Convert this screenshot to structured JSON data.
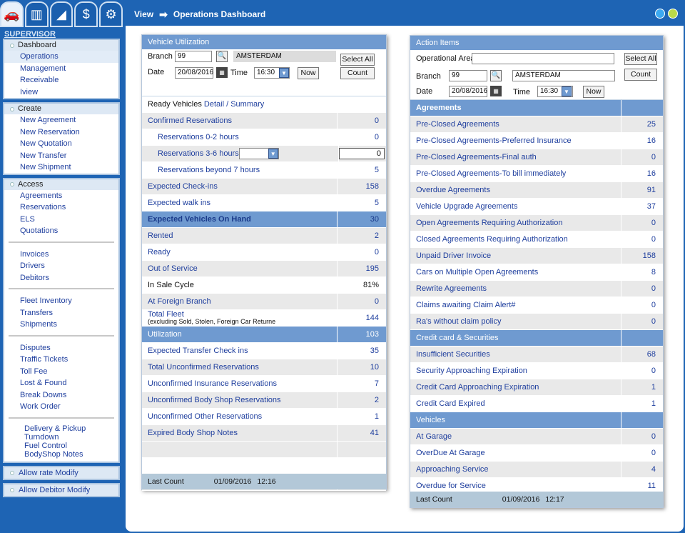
{
  "tabs": [
    {
      "icon": "car-icon"
    },
    {
      "icon": "chart-icon"
    },
    {
      "icon": "steps-icon"
    },
    {
      "icon": "dollar-icon"
    },
    {
      "icon": "gears-icon"
    }
  ],
  "sidebar": {
    "role": "SUPERVISOR",
    "dashboard": {
      "items": [
        "Dashboard",
        "Operations",
        "Management",
        "Receivable",
        "Iview"
      ]
    },
    "create": {
      "title": "Create",
      "items": [
        "New Agreement",
        "New Reservation",
        "New Quotation",
        "New Transfer",
        "New Shipment"
      ]
    },
    "access": {
      "title": "Access",
      "group1": [
        "Agreements",
        "Reservations",
        "ELS",
        "Quotations"
      ],
      "group2": [
        "Invoices",
        "Drivers",
        "Debitors"
      ],
      "group3": [
        "Fleet Inventory",
        "Transfers",
        "Shipments"
      ],
      "group4": [
        "Disputes",
        "Traffic Tickets",
        "Toll Fee",
        "Lost & Found",
        "Break Downs",
        "Work Order"
      ],
      "group5": [
        "Delivery & Pickup",
        "Turndown",
        "Fuel Control",
        "BodyShop Notes"
      ]
    },
    "allow_rate": "Allow rate Modify",
    "allow_debitor": "Allow Debitor Modify"
  },
  "header": {
    "view": "View",
    "arrow": "➡",
    "title": "Operations Dashboard"
  },
  "vehicle": {
    "title": "Vehicle Utilization",
    "branch_label": "Branch",
    "branch": "99",
    "branch_name": "AMSTERDAM",
    "date_label": "Date",
    "date": "20/08/2016",
    "time_label": "Time",
    "time": "16:30",
    "now": "Now",
    "select_all": "Select All",
    "count": "Count",
    "ready_vehicles": "Ready Vehicles",
    "detail": "Detail",
    "slash": "/",
    "summary": "Summary",
    "rows": [
      {
        "label": "Confirmed Reservations",
        "value": "0"
      },
      {
        "label": "Reservations 0-2 hours",
        "value": "0"
      },
      {
        "label": "Reservations 3-6 hours",
        "value": "0"
      },
      {
        "label": "Reservations beyond 7 hours",
        "value": "5"
      },
      {
        "label": "Expected Check-ins",
        "value": "158"
      },
      {
        "label": "Expected walk ins",
        "value": "5"
      },
      {
        "label": "Expected Vehicles On Hand",
        "value": "30"
      },
      {
        "label": "Rented",
        "value": "2"
      },
      {
        "label": "Ready",
        "value": "0"
      },
      {
        "label": "Out of Service",
        "value": "195"
      },
      {
        "label": "In Sale Cycle",
        "value": "81%"
      },
      {
        "label": "At Foreign Branch",
        "value": "0"
      },
      {
        "label": "Total Fleet",
        "sub": "(excluding Sold, Stolen, Foreign Car Returne",
        "value": "144"
      },
      {
        "label": "Utilization",
        "value": "103"
      },
      {
        "label": "Expected Transfer Check ins",
        "value": "35"
      },
      {
        "label": "Total Unconfirmed Reservations",
        "value": "10"
      },
      {
        "label": "Unconfirmed Insurance Reservations",
        "value": "7"
      },
      {
        "label": "Unconfirmed Body Shop Reservations",
        "value": "2"
      },
      {
        "label": "Unconfirmed Other Reservations",
        "value": "1"
      },
      {
        "label": "Expired Body Shop Notes",
        "value": "41"
      }
    ],
    "last_count_label": "Last Count",
    "last_date": "01/09/2016",
    "last_time": "12:16"
  },
  "actions": {
    "title": "Action Items",
    "area_label": "Operational Area",
    "area": "",
    "branch_label": "Branch",
    "branch": "99",
    "branch_name": "AMSTERDAM",
    "date_label": "Date",
    "date": "20/08/2016",
    "time_label": "Time",
    "time": "16:30",
    "now": "Now",
    "select_all": "Select All",
    "count": "Count",
    "sections": [
      {
        "title": "Agreements",
        "rows": [
          {
            "label": "Pre-Closed Agreements",
            "value": "25"
          },
          {
            "label": "Pre-Closed Agreements-Preferred Insurance",
            "value": "16"
          },
          {
            "label": "Pre-Closed Agreements-Final auth",
            "value": "0"
          },
          {
            "label": "Pre-Closed Agreements-To bill immediately",
            "value": "16"
          },
          {
            "label": "Overdue Agreements",
            "value": "91"
          },
          {
            "label": "Vehicle Upgrade Agreements",
            "value": "37"
          },
          {
            "label": "Open Agreements Requiring Authorization",
            "value": "0"
          },
          {
            "label": "Closed Agreements Requiring Authorization",
            "value": "0"
          },
          {
            "label": "Unpaid Driver Invoice",
            "value": "158"
          },
          {
            "label": "Cars on Multiple Open Agreements",
            "value": "8"
          },
          {
            "label": "Rewrite Agreements",
            "value": "0"
          },
          {
            "label": "Claims awaiting Claim Alert#",
            "value": "0"
          },
          {
            "label": "Ra's without claim policy",
            "value": "0"
          }
        ]
      },
      {
        "title": "Credit card & Securities",
        "rows": [
          {
            "label": "Insufficient Securities",
            "value": "68"
          },
          {
            "label": "Security Approaching Expiration",
            "value": "0"
          },
          {
            "label": "Credit Card Approaching Expiration",
            "value": "1"
          },
          {
            "label": "Credit Card Expired",
            "value": "1"
          }
        ]
      },
      {
        "title": "Vehicles",
        "rows": [
          {
            "label": "At Garage",
            "value": "0"
          },
          {
            "label": "OverDue At Garage",
            "value": "0"
          },
          {
            "label": "Approaching Service",
            "value": "4"
          },
          {
            "label": "Overdue for Service",
            "value": "11"
          }
        ]
      }
    ],
    "last_count_label": "Last Count",
    "last_date": "01/09/2016",
    "last_time": "12:17"
  },
  "colors": {
    "brand": "#1e64b4",
    "header_row": "#6f9ad0",
    "alt_row": "#e9e9e9",
    "footer": "#b3c8d8"
  }
}
